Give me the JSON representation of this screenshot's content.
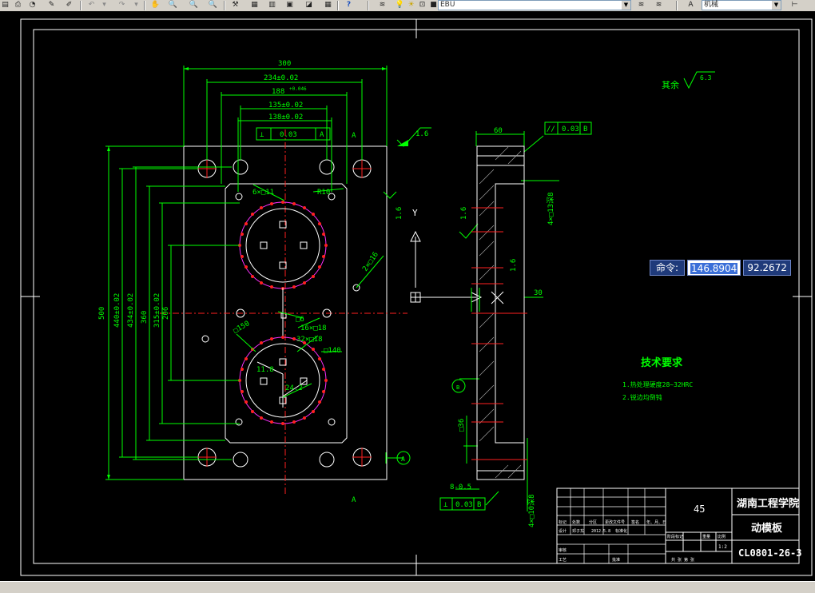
{
  "toolbar": {
    "layer_combo": "EBU",
    "style_combo": "机械"
  },
  "cmd_tooltip": {
    "label": "命令:",
    "x_value": "146.8904",
    "y_value": "92.2672"
  },
  "drawing": {
    "dims": {
      "width_300": "300",
      "w_234": "234±0.02",
      "w_188": "188",
      "w_188_tol": "+0.046",
      "w_135": "135±0.02",
      "w_138": "138±0.02",
      "h_500": "500",
      "h_440": "440±0.02",
      "h_434": "434±0.02",
      "h_360": "360",
      "h_315": "315±0.02",
      "h_206": "206",
      "side_60": "60",
      "side_30": "30",
      "dim_6x11": "6×□11",
      "dim_r10": "R10",
      "dim_2x16": "2×□16",
      "dim_c6": "□6",
      "dim_16x18": "16×□18",
      "dim_32x18": "32×□18",
      "dim_150": "□150",
      "dim_140": "□140",
      "dim_11_8": "11.8",
      "dim_24_2": "24.2",
      "dim_36": "□36",
      "dim_4x13": "4×□13深8",
      "dim_8_05": "8-0.5",
      "dim_4x10": "4×□10深8",
      "d1_6a": "1.6",
      "d1_6b": "1.6",
      "d1_6c": "1.6",
      "d1_6d": "1.6",
      "sec_a1": "A",
      "sec_a2": "A",
      "datum_a": "A",
      "axis_y": "Y",
      "label_b": "B"
    },
    "gdt": {
      "perp_sym": "⊥",
      "perp_val": "0.03",
      "perp_ref": "A",
      "par1_sym": "//",
      "par1_val": "0.03",
      "par1_ref": "B",
      "par2_sym": "⊥",
      "par2_val": "0.03",
      "par2_ref": "B"
    },
    "roughness_rest": "其余",
    "roughness_rest_val": "6.3",
    "roughness_top": "1.6",
    "tech_req": {
      "title": "技术要求",
      "item1": "1.热处理硬度28~32HRC",
      "item2": "2.锐边均倒钝"
    },
    "title_block": {
      "material": "45",
      "school": "湖南工程学院",
      "part_name": "动模板",
      "drawing_no": "CL0801-26-3",
      "scale": "1:2",
      "row_biaoji": "标记",
      "row_chushu": "处数",
      "row_fenqu": "分区",
      "row_gengai": "更改文件号",
      "row_qianming": "签名",
      "row_date": "年、月、日",
      "row_sheji": "设计",
      "row_designer": "邓子东",
      "row_sheji_date": "2012.5.8",
      "row_biaozhunhua": "标准化",
      "jieduan": "阶段标记",
      "zhongliang": "重量",
      "bili": "比例",
      "shenhe": "审核",
      "gongyi": "工艺",
      "pizhun": "批准",
      "gong_zhang": "共 张 第 张"
    }
  }
}
